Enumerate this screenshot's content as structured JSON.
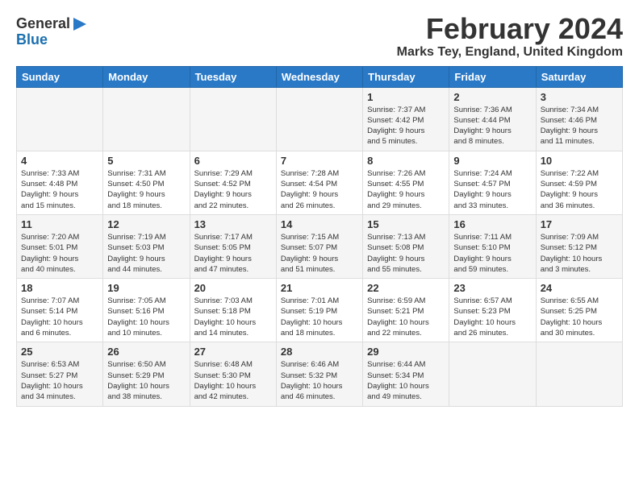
{
  "header": {
    "logo_general": "General",
    "logo_blue": "Blue",
    "month_title": "February 2024",
    "location": "Marks Tey, England, United Kingdom"
  },
  "days_of_week": [
    "Sunday",
    "Monday",
    "Tuesday",
    "Wednesday",
    "Thursday",
    "Friday",
    "Saturday"
  ],
  "weeks": [
    [
      {
        "day": "",
        "info": ""
      },
      {
        "day": "",
        "info": ""
      },
      {
        "day": "",
        "info": ""
      },
      {
        "day": "",
        "info": ""
      },
      {
        "day": "1",
        "info": "Sunrise: 7:37 AM\nSunset: 4:42 PM\nDaylight: 9 hours\nand 5 minutes."
      },
      {
        "day": "2",
        "info": "Sunrise: 7:36 AM\nSunset: 4:44 PM\nDaylight: 9 hours\nand 8 minutes."
      },
      {
        "day": "3",
        "info": "Sunrise: 7:34 AM\nSunset: 4:46 PM\nDaylight: 9 hours\nand 11 minutes."
      }
    ],
    [
      {
        "day": "4",
        "info": "Sunrise: 7:33 AM\nSunset: 4:48 PM\nDaylight: 9 hours\nand 15 minutes."
      },
      {
        "day": "5",
        "info": "Sunrise: 7:31 AM\nSunset: 4:50 PM\nDaylight: 9 hours\nand 18 minutes."
      },
      {
        "day": "6",
        "info": "Sunrise: 7:29 AM\nSunset: 4:52 PM\nDaylight: 9 hours\nand 22 minutes."
      },
      {
        "day": "7",
        "info": "Sunrise: 7:28 AM\nSunset: 4:54 PM\nDaylight: 9 hours\nand 26 minutes."
      },
      {
        "day": "8",
        "info": "Sunrise: 7:26 AM\nSunset: 4:55 PM\nDaylight: 9 hours\nand 29 minutes."
      },
      {
        "day": "9",
        "info": "Sunrise: 7:24 AM\nSunset: 4:57 PM\nDaylight: 9 hours\nand 33 minutes."
      },
      {
        "day": "10",
        "info": "Sunrise: 7:22 AM\nSunset: 4:59 PM\nDaylight: 9 hours\nand 36 minutes."
      }
    ],
    [
      {
        "day": "11",
        "info": "Sunrise: 7:20 AM\nSunset: 5:01 PM\nDaylight: 9 hours\nand 40 minutes."
      },
      {
        "day": "12",
        "info": "Sunrise: 7:19 AM\nSunset: 5:03 PM\nDaylight: 9 hours\nand 44 minutes."
      },
      {
        "day": "13",
        "info": "Sunrise: 7:17 AM\nSunset: 5:05 PM\nDaylight: 9 hours\nand 47 minutes."
      },
      {
        "day": "14",
        "info": "Sunrise: 7:15 AM\nSunset: 5:07 PM\nDaylight: 9 hours\nand 51 minutes."
      },
      {
        "day": "15",
        "info": "Sunrise: 7:13 AM\nSunset: 5:08 PM\nDaylight: 9 hours\nand 55 minutes."
      },
      {
        "day": "16",
        "info": "Sunrise: 7:11 AM\nSunset: 5:10 PM\nDaylight: 9 hours\nand 59 minutes."
      },
      {
        "day": "17",
        "info": "Sunrise: 7:09 AM\nSunset: 5:12 PM\nDaylight: 10 hours\nand 3 minutes."
      }
    ],
    [
      {
        "day": "18",
        "info": "Sunrise: 7:07 AM\nSunset: 5:14 PM\nDaylight: 10 hours\nand 6 minutes."
      },
      {
        "day": "19",
        "info": "Sunrise: 7:05 AM\nSunset: 5:16 PM\nDaylight: 10 hours\nand 10 minutes."
      },
      {
        "day": "20",
        "info": "Sunrise: 7:03 AM\nSunset: 5:18 PM\nDaylight: 10 hours\nand 14 minutes."
      },
      {
        "day": "21",
        "info": "Sunrise: 7:01 AM\nSunset: 5:19 PM\nDaylight: 10 hours\nand 18 minutes."
      },
      {
        "day": "22",
        "info": "Sunrise: 6:59 AM\nSunset: 5:21 PM\nDaylight: 10 hours\nand 22 minutes."
      },
      {
        "day": "23",
        "info": "Sunrise: 6:57 AM\nSunset: 5:23 PM\nDaylight: 10 hours\nand 26 minutes."
      },
      {
        "day": "24",
        "info": "Sunrise: 6:55 AM\nSunset: 5:25 PM\nDaylight: 10 hours\nand 30 minutes."
      }
    ],
    [
      {
        "day": "25",
        "info": "Sunrise: 6:53 AM\nSunset: 5:27 PM\nDaylight: 10 hours\nand 34 minutes."
      },
      {
        "day": "26",
        "info": "Sunrise: 6:50 AM\nSunset: 5:29 PM\nDaylight: 10 hours\nand 38 minutes."
      },
      {
        "day": "27",
        "info": "Sunrise: 6:48 AM\nSunset: 5:30 PM\nDaylight: 10 hours\nand 42 minutes."
      },
      {
        "day": "28",
        "info": "Sunrise: 6:46 AM\nSunset: 5:32 PM\nDaylight: 10 hours\nand 46 minutes."
      },
      {
        "day": "29",
        "info": "Sunrise: 6:44 AM\nSunset: 5:34 PM\nDaylight: 10 hours\nand 49 minutes."
      },
      {
        "day": "",
        "info": ""
      },
      {
        "day": "",
        "info": ""
      }
    ]
  ]
}
